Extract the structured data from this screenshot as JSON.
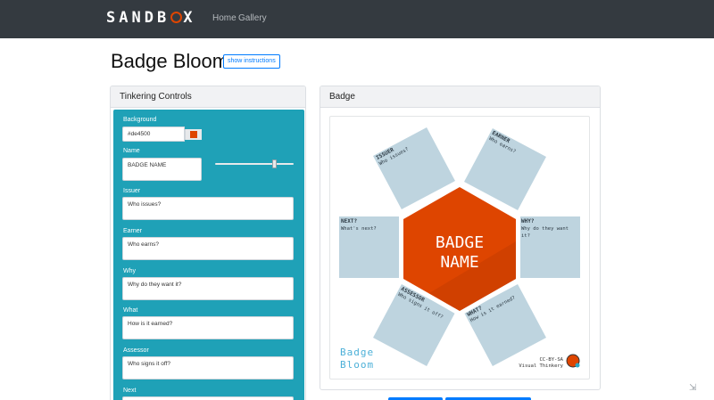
{
  "nav": {
    "brand_before": "SANDB",
    "brand_after": "X",
    "links": [
      "Home",
      "Gallery"
    ]
  },
  "page": {
    "title": "Badge Bloom",
    "instructions_button": "show instructions"
  },
  "controls_card": {
    "title": "Tinkering Controls",
    "background_label": "Background",
    "background_value": "#de4500",
    "name_label": "Name",
    "name_value": "BADGE NAME",
    "slider_value": 0.75,
    "fields": [
      {
        "label": "Issuer",
        "value": "Who issues?"
      },
      {
        "label": "Earner",
        "value": "Who earns?"
      },
      {
        "label": "Why",
        "value": "Why do they want  it?"
      },
      {
        "label": "What",
        "value": "How is it earned?"
      },
      {
        "label": "Assessor",
        "value": "Who signs it off?"
      },
      {
        "label": "Next",
        "value": ""
      }
    ]
  },
  "badge_card": {
    "title": "Badge",
    "center_line1": "BADGE",
    "center_line2": "NAME",
    "petals": {
      "issuer": {
        "title": "ISSUER",
        "text": "Who issues?"
      },
      "earner": {
        "title": "EARNER",
        "text": "Who earns?"
      },
      "next": {
        "title": "NEXT?",
        "text": "What's next?"
      },
      "why": {
        "title": "WHY?",
        "text": "Why do they want",
        "text2": "it?"
      },
      "assessor": {
        "title": "ASSESSOR",
        "text": "Who signs it off?"
      },
      "what": {
        "title": "WHAT?",
        "text": "How is it earned?"
      }
    },
    "watermark_line1": "Badge",
    "watermark_line2": "Bloom",
    "license_line1": "CC-BY-SA",
    "license_line2": "Visual Thinkery"
  },
  "colors": {
    "navbar": "#343a40",
    "controls_bg": "#1fa1b7",
    "badge_fill": "#de4500",
    "petal_fill": "#bed4df",
    "accent": "#007bff"
  }
}
